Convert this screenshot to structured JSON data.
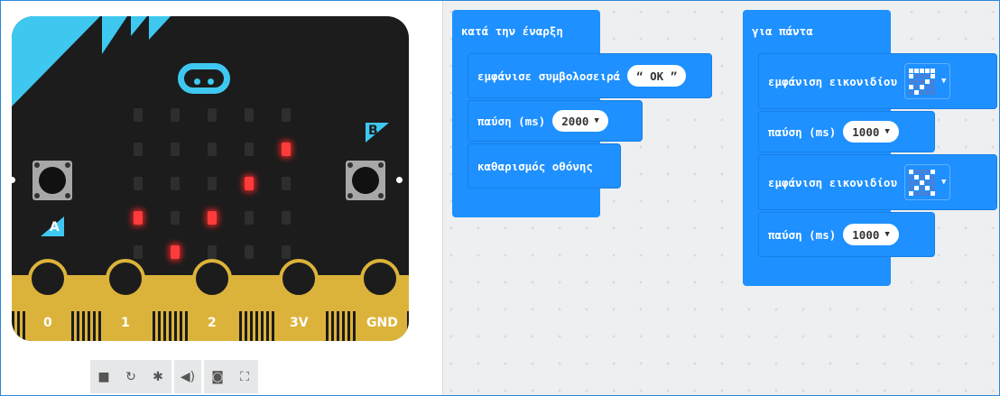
{
  "simulator": {
    "pins": [
      "0",
      "1",
      "2",
      "3V",
      "GND"
    ],
    "button_a": "A",
    "button_b": "B",
    "leds": [
      [
        0,
        0,
        0,
        0,
        0
      ],
      [
        0,
        0,
        0,
        0,
        1
      ],
      [
        0,
        0,
        0,
        1,
        0
      ],
      [
        1,
        0,
        1,
        0,
        0
      ],
      [
        0,
        1,
        0,
        0,
        0
      ]
    ],
    "toolbar_icons": [
      "stop-icon",
      "restart-icon",
      "debug-icon",
      "sound-icon",
      "screenshot-icon",
      "fullscreen-icon"
    ],
    "toolbar_glyphs": [
      "■",
      "↻",
      "✱",
      "◀)",
      "◙",
      "⛶"
    ]
  },
  "blocks": {
    "on_start": {
      "label": "κατά την έναρξη",
      "show_string": {
        "label": "εμφάνισε συμβολοσειρά",
        "value": "OK"
      },
      "pause": {
        "label": "παύση (ms)",
        "value": "2000"
      },
      "clear": {
        "label": "καθαρισμός οθόνης"
      }
    },
    "forever": {
      "label": "για πάντα",
      "show_icon_1": {
        "label": "εμφάνιση εικονιδίου",
        "pattern": [
          [
            1,
            1,
            1,
            1,
            1
          ],
          [
            1,
            0,
            0,
            0,
            1
          ],
          [
            0,
            0,
            0,
            1,
            0
          ],
          [
            1,
            0,
            1,
            0,
            0
          ],
          [
            0,
            1,
            0,
            0,
            0
          ]
        ]
      },
      "pause_1": {
        "label": "παύση (ms)",
        "value": "1000"
      },
      "show_icon_2": {
        "label": "εμφάνιση εικονιδίου",
        "pattern": [
          [
            1,
            0,
            0,
            0,
            1
          ],
          [
            0,
            1,
            0,
            1,
            0
          ],
          [
            0,
            0,
            1,
            0,
            0
          ],
          [
            0,
            1,
            0,
            1,
            0
          ],
          [
            1,
            0,
            0,
            0,
            1
          ]
        ]
      },
      "pause_2": {
        "label": "παύση (ms)",
        "value": "1000"
      }
    }
  },
  "colors": {
    "block": "#1e90ff",
    "led_on": "#ff3b3b",
    "edge": "#dcb33a",
    "accent": "#3ec8f0"
  }
}
